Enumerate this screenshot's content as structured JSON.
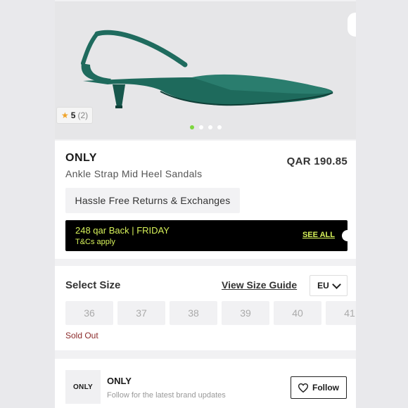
{
  "product": {
    "rating_score": "5",
    "rating_count": "(2)",
    "brand": "ONLY",
    "name": "Ankle Strap Mid Heel Sandals",
    "price": "QAR 190.85",
    "returns_label": "Hassle Free Returns & Exchanges",
    "image_dots": 4,
    "active_dot": 0
  },
  "cashback": {
    "main": "248 qar Back | FRIDAY",
    "sub": "T&Cs apply",
    "see_all": "SEE ALL"
  },
  "size_section": {
    "title": "Select Size",
    "guide_link": "View Size Guide",
    "region": "EU",
    "sizes": [
      "36",
      "37",
      "38",
      "39",
      "40",
      "41"
    ],
    "status": "Sold Out"
  },
  "brand_follow": {
    "logo_text": "ONLY",
    "brand": "ONLY",
    "subtitle": "Follow for the latest brand updates",
    "button_label": "Follow"
  },
  "colors": {
    "accent_lime": "#d7f25a",
    "dot_active": "#7dd63f",
    "sold_out": "#8b2a2a",
    "shoe": "#1f6b5e"
  },
  "icons": [
    "star-icon",
    "chevron-down-icon",
    "heart-icon"
  ]
}
